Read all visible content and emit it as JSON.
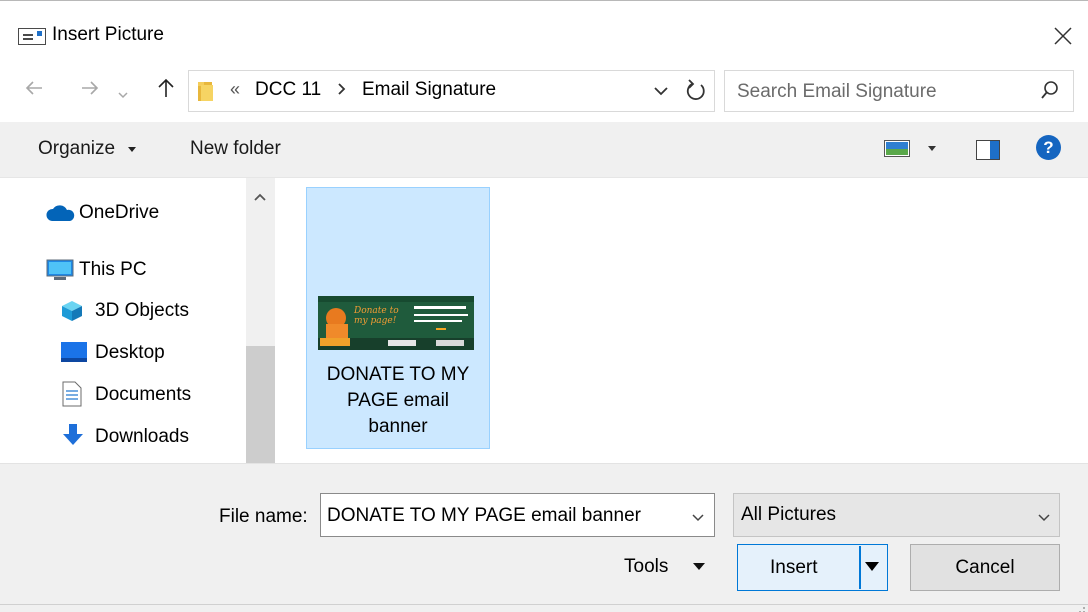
{
  "window": {
    "title": "Insert Picture"
  },
  "address": {
    "crumbs": [
      "DCC 11",
      "Email Signature"
    ],
    "overflow": "«"
  },
  "search": {
    "placeholder": "Search Email Signature"
  },
  "toolbar": {
    "organize": "Organize",
    "new_folder": "New folder",
    "help": "?"
  },
  "nav": {
    "items": [
      {
        "label": "OneDrive",
        "icon": "cloud-icon"
      },
      {
        "label": "This PC",
        "icon": "computer-icon"
      },
      {
        "label": "3D Objects",
        "icon": "cube-icon"
      },
      {
        "label": "Desktop",
        "icon": "desktop-icon"
      },
      {
        "label": "Documents",
        "icon": "document-icon"
      },
      {
        "label": "Downloads",
        "icon": "download-icon"
      }
    ]
  },
  "files": [
    {
      "name": "DONATE TO MY PAGE email banner",
      "name_lines": [
        "DONATE TO MY",
        "PAGE email",
        "banner"
      ],
      "thumb": {
        "script": "Donate to my page!",
        "date": "APRIL 10, 2021",
        "line2": "WALK. RUN. RIDE. CELEBRATE",
        "line3": "CLIMATE SUPPORT SPEED",
        "brand": "HURRICANES"
      }
    }
  ],
  "footer": {
    "file_name_label": "File name:",
    "file_name_value": "DONATE TO MY PAGE email banner",
    "file_type": "All Pictures",
    "tools": "Tools",
    "insert": "Insert",
    "cancel": "Cancel"
  },
  "colors": {
    "accent": "#0078d7",
    "selection": "#cce8ff",
    "toolbar_bg": "#f0f0f0"
  }
}
